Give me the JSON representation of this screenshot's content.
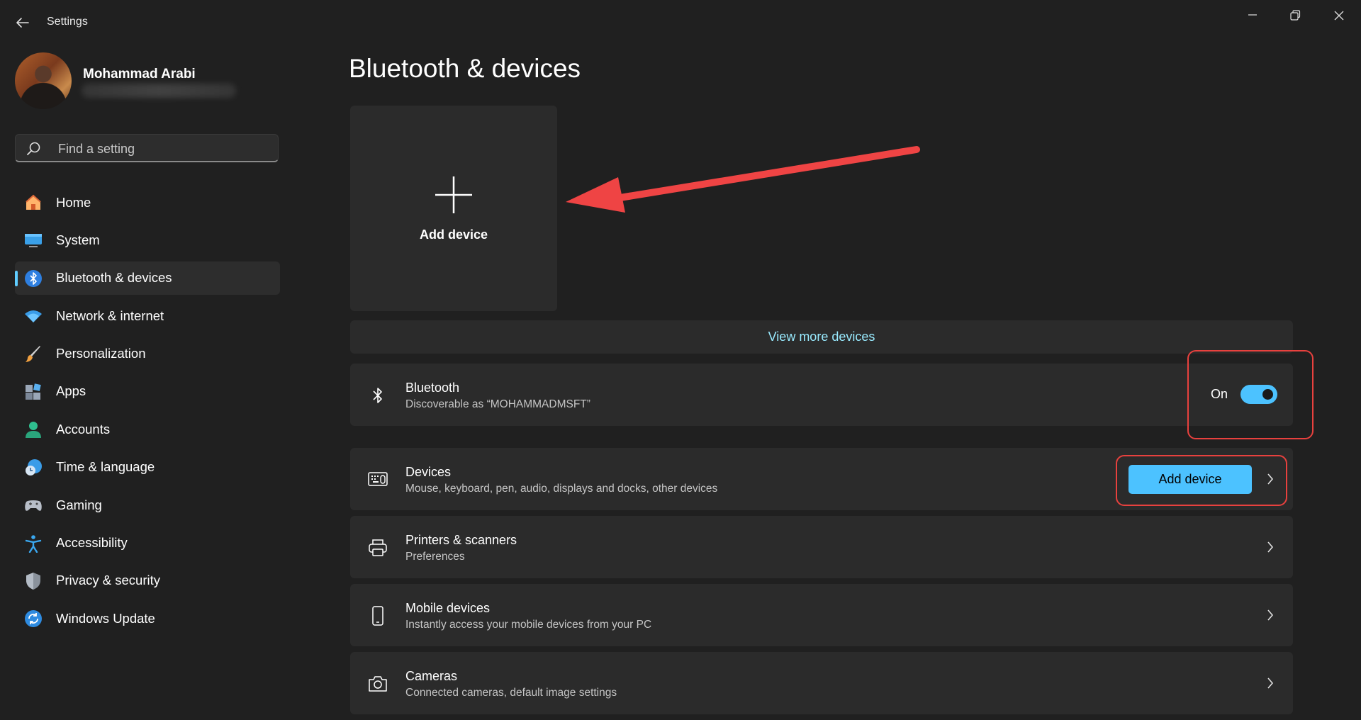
{
  "window": {
    "title": "Settings"
  },
  "user": {
    "name": "Mohammad Arabi"
  },
  "search": {
    "placeholder": "Find a setting"
  },
  "sidebar": {
    "items": [
      {
        "label": "Home",
        "icon": "home-icon",
        "active": false
      },
      {
        "label": "System",
        "icon": "system-icon",
        "active": false
      },
      {
        "label": "Bluetooth & devices",
        "icon": "bluetooth-icon",
        "active": true
      },
      {
        "label": "Network & internet",
        "icon": "wifi-icon",
        "active": false
      },
      {
        "label": "Personalization",
        "icon": "brush-icon",
        "active": false
      },
      {
        "label": "Apps",
        "icon": "apps-icon",
        "active": false
      },
      {
        "label": "Accounts",
        "icon": "person-icon",
        "active": false
      },
      {
        "label": "Time & language",
        "icon": "globe-clock-icon",
        "active": false
      },
      {
        "label": "Gaming",
        "icon": "controller-icon",
        "active": false
      },
      {
        "label": "Accessibility",
        "icon": "accessibility-icon",
        "active": false
      },
      {
        "label": "Privacy & security",
        "icon": "shield-icon",
        "active": false
      },
      {
        "label": "Windows Update",
        "icon": "update-icon",
        "active": false
      }
    ]
  },
  "main": {
    "title": "Bluetooth & devices",
    "add_tile_label": "Add device",
    "view_more": "View more devices",
    "bluetooth": {
      "title": "Bluetooth",
      "subtitle": "Discoverable as “MOHAMMADMSFT”",
      "state_label": "On",
      "enabled": true
    },
    "devices": {
      "title": "Devices",
      "subtitle": "Mouse, keyboard, pen, audio, displays and docks, other devices",
      "button": "Add device"
    },
    "printers": {
      "title": "Printers & scanners",
      "subtitle": "Preferences"
    },
    "mobile": {
      "title": "Mobile devices",
      "subtitle": "Instantly access your mobile devices from your PC"
    },
    "cameras": {
      "title": "Cameras",
      "subtitle": "Connected cameras, default image settings"
    }
  },
  "colors": {
    "accent": "#4cc2ff",
    "annotation": "#e8413e",
    "background": "#202020",
    "card": "#2b2b2b"
  }
}
